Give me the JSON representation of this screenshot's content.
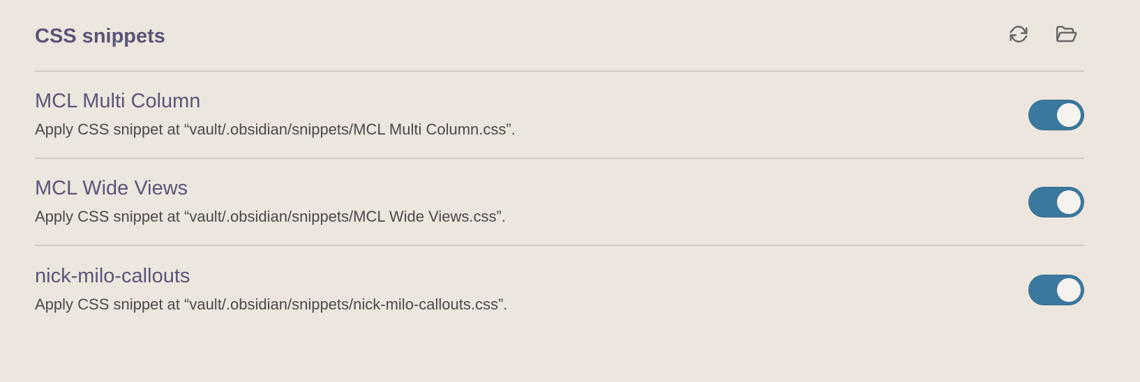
{
  "header": {
    "title": "CSS snippets",
    "actions": [
      {
        "icon": "reload-icon"
      },
      {
        "icon": "folder-open-icon"
      }
    ]
  },
  "snippets": [
    {
      "name": "MCL Multi Column",
      "description": "Apply CSS snippet at “vault/.obsidian/snippets/MCL Multi Column.css”.",
      "enabled": true
    },
    {
      "name": "MCL Wide Views",
      "description": "Apply CSS snippet at “vault/.obsidian/snippets/MCL Wide Views.css”.",
      "enabled": true
    },
    {
      "name": "nick-milo-callouts",
      "description": "Apply CSS snippet at “vault/.obsidian/snippets/nick-milo-callouts.css”.",
      "enabled": true
    }
  ],
  "colors": {
    "background": "#ede6df",
    "accent": "#3a789d",
    "title_text": "#5a5478",
    "divider": "#d2cbc4"
  }
}
